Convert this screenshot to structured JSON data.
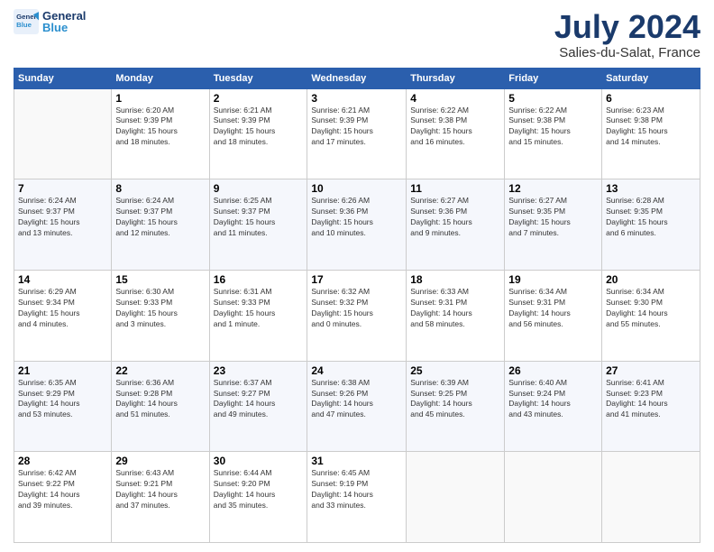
{
  "header": {
    "logo_line1": "General",
    "logo_line2": "Blue",
    "month": "July 2024",
    "location": "Salies-du-Salat, France"
  },
  "weekdays": [
    "Sunday",
    "Monday",
    "Tuesday",
    "Wednesday",
    "Thursday",
    "Friday",
    "Saturday"
  ],
  "weeks": [
    [
      {
        "day": "",
        "info": ""
      },
      {
        "day": "1",
        "info": "Sunrise: 6:20 AM\nSunset: 9:39 PM\nDaylight: 15 hours\nand 18 minutes."
      },
      {
        "day": "2",
        "info": "Sunrise: 6:21 AM\nSunset: 9:39 PM\nDaylight: 15 hours\nand 18 minutes."
      },
      {
        "day": "3",
        "info": "Sunrise: 6:21 AM\nSunset: 9:39 PM\nDaylight: 15 hours\nand 17 minutes."
      },
      {
        "day": "4",
        "info": "Sunrise: 6:22 AM\nSunset: 9:38 PM\nDaylight: 15 hours\nand 16 minutes."
      },
      {
        "day": "5",
        "info": "Sunrise: 6:22 AM\nSunset: 9:38 PM\nDaylight: 15 hours\nand 15 minutes."
      },
      {
        "day": "6",
        "info": "Sunrise: 6:23 AM\nSunset: 9:38 PM\nDaylight: 15 hours\nand 14 minutes."
      }
    ],
    [
      {
        "day": "7",
        "info": "Sunrise: 6:24 AM\nSunset: 9:37 PM\nDaylight: 15 hours\nand 13 minutes."
      },
      {
        "day": "8",
        "info": "Sunrise: 6:24 AM\nSunset: 9:37 PM\nDaylight: 15 hours\nand 12 minutes."
      },
      {
        "day": "9",
        "info": "Sunrise: 6:25 AM\nSunset: 9:37 PM\nDaylight: 15 hours\nand 11 minutes."
      },
      {
        "day": "10",
        "info": "Sunrise: 6:26 AM\nSunset: 9:36 PM\nDaylight: 15 hours\nand 10 minutes."
      },
      {
        "day": "11",
        "info": "Sunrise: 6:27 AM\nSunset: 9:36 PM\nDaylight: 15 hours\nand 9 minutes."
      },
      {
        "day": "12",
        "info": "Sunrise: 6:27 AM\nSunset: 9:35 PM\nDaylight: 15 hours\nand 7 minutes."
      },
      {
        "day": "13",
        "info": "Sunrise: 6:28 AM\nSunset: 9:35 PM\nDaylight: 15 hours\nand 6 minutes."
      }
    ],
    [
      {
        "day": "14",
        "info": "Sunrise: 6:29 AM\nSunset: 9:34 PM\nDaylight: 15 hours\nand 4 minutes."
      },
      {
        "day": "15",
        "info": "Sunrise: 6:30 AM\nSunset: 9:33 PM\nDaylight: 15 hours\nand 3 minutes."
      },
      {
        "day": "16",
        "info": "Sunrise: 6:31 AM\nSunset: 9:33 PM\nDaylight: 15 hours\nand 1 minute."
      },
      {
        "day": "17",
        "info": "Sunrise: 6:32 AM\nSunset: 9:32 PM\nDaylight: 15 hours\nand 0 minutes."
      },
      {
        "day": "18",
        "info": "Sunrise: 6:33 AM\nSunset: 9:31 PM\nDaylight: 14 hours\nand 58 minutes."
      },
      {
        "day": "19",
        "info": "Sunrise: 6:34 AM\nSunset: 9:31 PM\nDaylight: 14 hours\nand 56 minutes."
      },
      {
        "day": "20",
        "info": "Sunrise: 6:34 AM\nSunset: 9:30 PM\nDaylight: 14 hours\nand 55 minutes."
      }
    ],
    [
      {
        "day": "21",
        "info": "Sunrise: 6:35 AM\nSunset: 9:29 PM\nDaylight: 14 hours\nand 53 minutes."
      },
      {
        "day": "22",
        "info": "Sunrise: 6:36 AM\nSunset: 9:28 PM\nDaylight: 14 hours\nand 51 minutes."
      },
      {
        "day": "23",
        "info": "Sunrise: 6:37 AM\nSunset: 9:27 PM\nDaylight: 14 hours\nand 49 minutes."
      },
      {
        "day": "24",
        "info": "Sunrise: 6:38 AM\nSunset: 9:26 PM\nDaylight: 14 hours\nand 47 minutes."
      },
      {
        "day": "25",
        "info": "Sunrise: 6:39 AM\nSunset: 9:25 PM\nDaylight: 14 hours\nand 45 minutes."
      },
      {
        "day": "26",
        "info": "Sunrise: 6:40 AM\nSunset: 9:24 PM\nDaylight: 14 hours\nand 43 minutes."
      },
      {
        "day": "27",
        "info": "Sunrise: 6:41 AM\nSunset: 9:23 PM\nDaylight: 14 hours\nand 41 minutes."
      }
    ],
    [
      {
        "day": "28",
        "info": "Sunrise: 6:42 AM\nSunset: 9:22 PM\nDaylight: 14 hours\nand 39 minutes."
      },
      {
        "day": "29",
        "info": "Sunrise: 6:43 AM\nSunset: 9:21 PM\nDaylight: 14 hours\nand 37 minutes."
      },
      {
        "day": "30",
        "info": "Sunrise: 6:44 AM\nSunset: 9:20 PM\nDaylight: 14 hours\nand 35 minutes."
      },
      {
        "day": "31",
        "info": "Sunrise: 6:45 AM\nSunset: 9:19 PM\nDaylight: 14 hours\nand 33 minutes."
      },
      {
        "day": "",
        "info": ""
      },
      {
        "day": "",
        "info": ""
      },
      {
        "day": "",
        "info": ""
      }
    ]
  ]
}
